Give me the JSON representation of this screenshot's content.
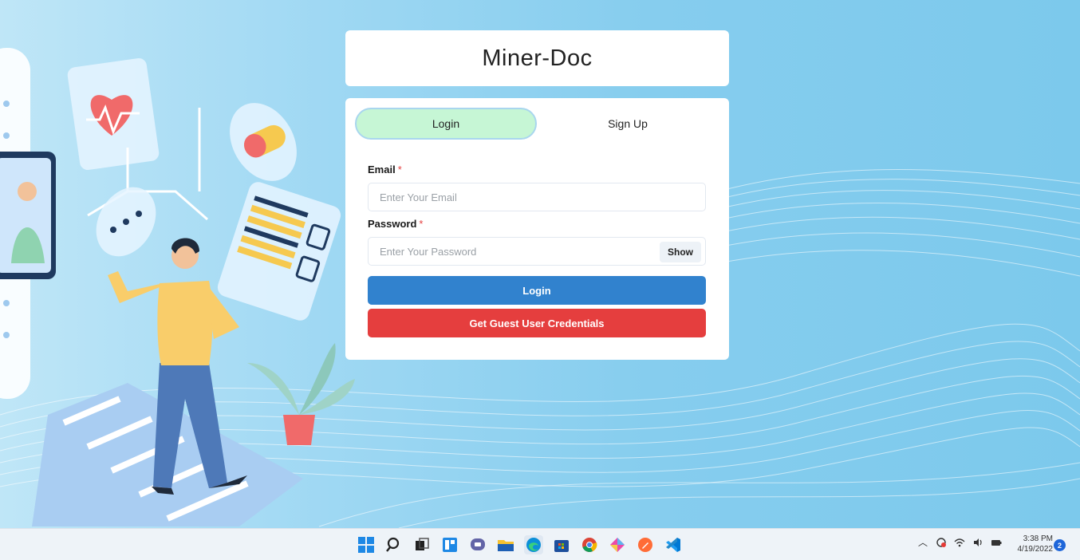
{
  "app": {
    "title": "Miner-Doc"
  },
  "tabs": [
    {
      "label": "Login",
      "active": true
    },
    {
      "label": "Sign Up",
      "active": false
    }
  ],
  "form": {
    "email_label": "Email",
    "email_placeholder": "Enter Your Email",
    "password_label": "Password",
    "password_placeholder": "Enter Your Password",
    "required_mark": "*",
    "show_label": "Show",
    "login_button": "Login",
    "guest_button": "Get Guest User Credentials"
  },
  "colors": {
    "primary": "#3182ce",
    "danger": "#e53e3e",
    "active_tab": "#c6f6d5",
    "taskbar": "#eef3f8"
  },
  "taskbar": {
    "apps": [
      "windows-start-icon",
      "search-icon",
      "task-view-icon",
      "widgets-icon",
      "teams-chat-icon",
      "file-explorer-icon",
      "edge-browser-icon",
      "microsoft-store-icon",
      "chrome-icon",
      "sourcetree-icon",
      "postman-icon",
      "vscode-icon"
    ],
    "tray": [
      "chevron-up-icon",
      "onedrive-icon",
      "wifi-icon",
      "volume-icon",
      "battery-icon"
    ],
    "time": "3:38 PM",
    "date": "4/19/2022",
    "notification_count": "2"
  }
}
